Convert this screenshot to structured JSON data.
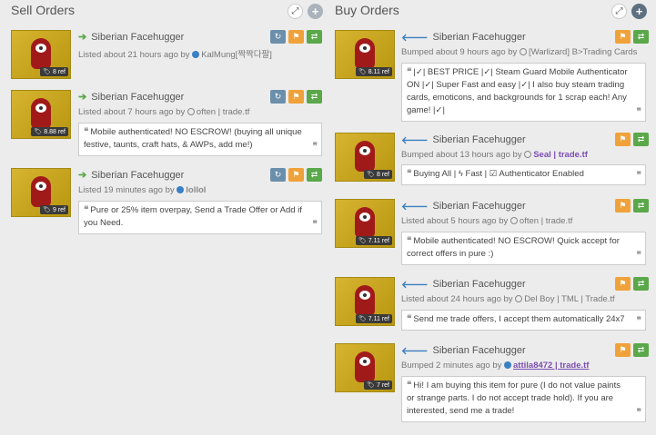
{
  "sell": {
    "title": "Sell Orders",
    "orders": [
      {
        "name": "Siberian Facehugger",
        "price": "8 ref",
        "meta": "Listed about 21 hours ago by ",
        "user": "KalMung[짝짝다팔]",
        "comment": ""
      },
      {
        "name": "Siberian Facehugger",
        "price": "8.88 ref",
        "meta": "Listed about 7 hours ago by ",
        "user": "often | trade.tf",
        "comment": "Mobile authenticated! NO ESCROW! (buying all unique festive, taunts, craft hats, & AWPs, add me!)"
      },
      {
        "name": "Siberian Facehugger",
        "price": "9 ref",
        "meta": "Listed 19 minutes ago by ",
        "user": "lollol",
        "comment": "Pure or 25% item overpay, Send a Trade Offer or Add if you Need."
      }
    ]
  },
  "buy": {
    "title": "Buy Orders",
    "orders": [
      {
        "name": "Siberian Facehugger",
        "price": "8.11 ref",
        "meta": "Bumped about 9 hours ago by ",
        "user": "[Warlizard] B>Trading Cards",
        "comment": "|✓| BEST PRICE |✓| Steam Guard Mobile Authenticator ON |✓| Super Fast and easy |✓| I also buy steam trading cards, emoticons, and backgrounds for 1 scrap each! Any game! |✓|"
      },
      {
        "name": "Siberian Facehugger",
        "price": "8 ref",
        "meta": "Bumped about 13 hours ago by ",
        "user": "Seal | trade.tf",
        "comment": "Buying All | ϟ Fast | ☑ Authenticator Enabled"
      },
      {
        "name": "Siberian Facehugger",
        "price": "7.11 ref",
        "meta": "Listed about 5 hours ago by ",
        "user": "often | trade.tf",
        "comment": "Mobile authenticated! NO ESCROW! Quick accept for correct offers in pure :)"
      },
      {
        "name": "Siberian Facehugger",
        "price": "7.11 ref",
        "meta": "Listed about 24 hours ago by ",
        "user": "Del Boy | TML | Trade.tf",
        "comment": "Send me trade offers, I accept them automatically 24x7"
      },
      {
        "name": "Siberian Facehugger",
        "price": "7 ref",
        "meta": "Bumped 2 minutes ago by ",
        "user": "attila8472 | trade.tf",
        "comment": "Hi! I am buying this item for pure (I do not value paints or strange parts. I do not accept trade hold). If you are interested, send me a trade!"
      }
    ]
  },
  "icons": {
    "expand": "⤢",
    "add": "+",
    "bump": "↻",
    "report": "⚑",
    "trade": "⇄",
    "sell_arrow": "➔",
    "buy_arrow": "🡐",
    "quote_open": "❝",
    "quote_close": "❞",
    "price_tag": "🏷"
  },
  "colors": {
    "accent_green": "#5aa84a",
    "accent_orange": "#f0a23a",
    "accent_blue": "#3a80c5",
    "bump_blue": "#6b8fab",
    "purple_user": "#7b4eb3",
    "item_gold": "#c9a820"
  }
}
